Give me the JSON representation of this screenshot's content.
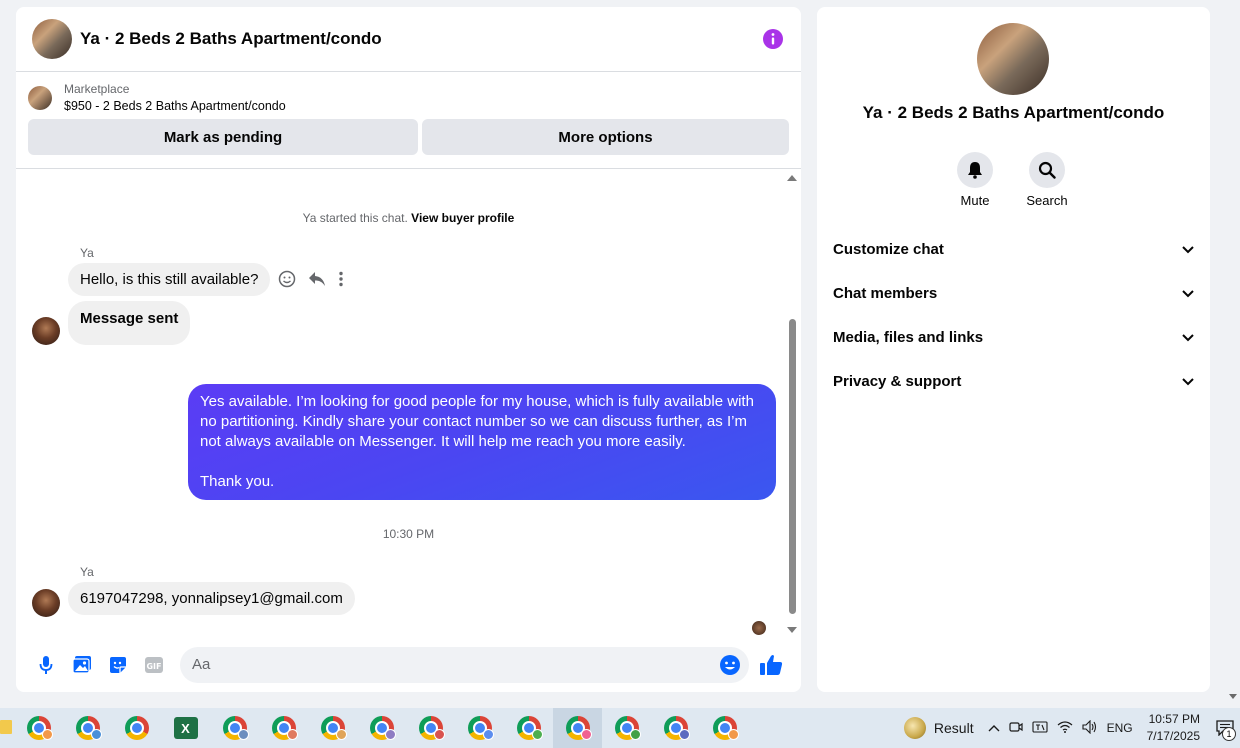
{
  "chat": {
    "title": "Ya · 2 Beds 2 Baths Apartment/condo",
    "marketplace_label": "Marketplace",
    "listing": "$950 - 2 Beds 2 Baths Apartment/condo",
    "mark_pending": "Mark as pending",
    "more_options": "More options",
    "system_text": "Ya started this chat.",
    "view_profile": "View buyer profile",
    "messages": [
      {
        "sender": "Ya",
        "text": "Hello, is this still available?"
      },
      {
        "text": "Message sent"
      },
      {
        "text_lines": [
          "Yes available. I’m looking for good people for my house, which is fully available with",
          "no partitioning. Kindly share your contact number so we can discuss further, as I’m",
          "not always available on Messenger. It will help me reach you more easily.",
          "",
          "Thank you."
        ]
      },
      {
        "timestamp": "10:30 PM"
      },
      {
        "sender": "Ya",
        "text": "6197047298, yonnalipsey1@gmail.com"
      }
    ],
    "composer_placeholder": "Aa"
  },
  "info": {
    "title": "Ya · 2 Beds 2 Baths Apartment/condo",
    "mute": "Mute",
    "search": "Search",
    "sections": [
      "Customize chat",
      "Chat members",
      "Media, files and links",
      "Privacy & support"
    ]
  },
  "taskbar": {
    "weather": "Result",
    "lang": "ENG",
    "time": "10:57 PM",
    "date": "7/17/2025",
    "notif_count": "1",
    "profile_colors": [
      "#f2994a",
      "#4a90d9",
      "#6c8ebf",
      "#e07a5f",
      "#e0a458",
      "#8e7cc3",
      "#d9534f",
      "#5b8def",
      "#4caf50",
      "#f06292",
      "#43a047",
      "#5c6bc0"
    ]
  },
  "colors": {
    "accent": "#0866ff",
    "info_icon": "#a933e8",
    "outgoing_bubble": "#4b46f2"
  }
}
